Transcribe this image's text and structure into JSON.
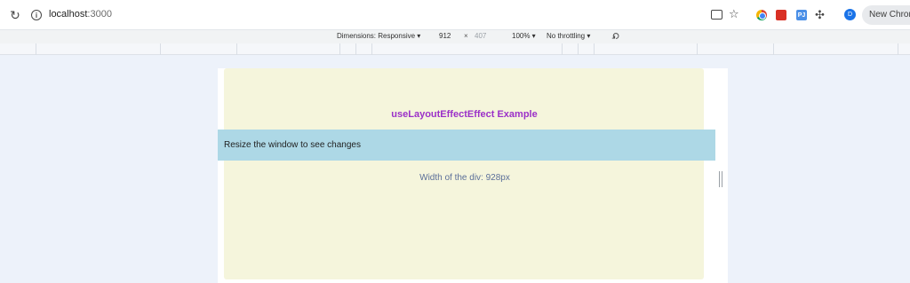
{
  "browser": {
    "url_host": "localhost",
    "url_port": ":3000",
    "avatar_initial": "D",
    "new_chrome_label": "New Chrom",
    "ext3_label": "PJ"
  },
  "device_toolbar": {
    "dimensions_label": "Dimensions: Responsive ▾",
    "width_value": "912",
    "times": "×",
    "height_value": "407",
    "zoom_label": "100% ▾",
    "throttle_label": "No throttling ▾"
  },
  "page": {
    "heading": "useLayoutEffectEffect Example",
    "instruction": "Resize the window to see changes",
    "width_text": "Width of the div: 928px"
  },
  "colors": {
    "heading": "#9b30c8",
    "band": "#add8e6",
    "app_background": "#f5f5dc",
    "width_text": "#5b6f99"
  }
}
